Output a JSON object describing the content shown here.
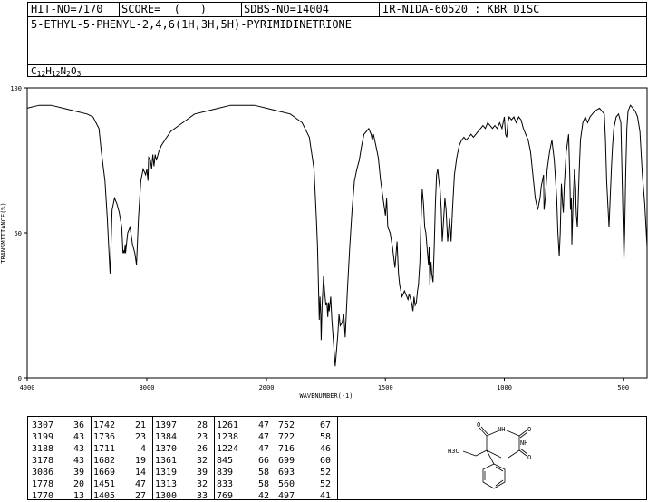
{
  "header": {
    "hit_no": "HIT-NO=7170",
    "score": "SCORE=  (   )",
    "sdbs_no": "SDBS-NO=14004",
    "ir_code": "IR-NIDA-60520 : KBR DISC",
    "compound_name": "5-ETHYL-5-PHENYL-2,4,6(1H,3H,5H)-PYRIMIDINETRIONE",
    "formula": {
      "c": "C",
      "c_n": "12",
      "h": "H",
      "h_n": "12",
      "n": "N",
      "n_n": "2",
      "o": "O",
      "o_n": "3"
    }
  },
  "chart_data": {
    "type": "line",
    "xlabel": "WAVENUMBER(-1)",
    "ylabel": "TRANSMITTANCE(%)",
    "xlim": [
      4000,
      400
    ],
    "ylim": [
      0,
      100
    ],
    "x_ticks": [
      "4000",
      "3000",
      "2000",
      "1500",
      "1000",
      "500"
    ],
    "y_ticks": [
      "100",
      "50",
      "0"
    ],
    "series": [
      {
        "points": [
          [
            4000,
            93
          ],
          [
            3900,
            94
          ],
          [
            3800,
            94
          ],
          [
            3700,
            93
          ],
          [
            3600,
            92
          ],
          [
            3500,
            91
          ],
          [
            3450,
            90
          ],
          [
            3400,
            86
          ],
          [
            3380,
            78
          ],
          [
            3350,
            68
          ],
          [
            3330,
            55
          ],
          [
            3310,
            38
          ],
          [
            3307,
            36
          ],
          [
            3300,
            45
          ],
          [
            3290,
            58
          ],
          [
            3270,
            62
          ],
          [
            3250,
            60
          ],
          [
            3230,
            57
          ],
          [
            3210,
            52
          ],
          [
            3199,
            43
          ],
          [
            3190,
            44
          ],
          [
            3188,
            43
          ],
          [
            3180,
            46
          ],
          [
            3178,
            43
          ],
          [
            3160,
            50
          ],
          [
            3140,
            52
          ],
          [
            3120,
            46
          ],
          [
            3100,
            43
          ],
          [
            3086,
            39
          ],
          [
            3070,
            55
          ],
          [
            3050,
            68
          ],
          [
            3030,
            72
          ],
          [
            3010,
            70
          ],
          [
            3000,
            72
          ],
          [
            2990,
            68
          ],
          [
            2985,
            76
          ],
          [
            2970,
            75
          ],
          [
            2960,
            72
          ],
          [
            2950,
            77
          ],
          [
            2940,
            73
          ],
          [
            2930,
            77
          ],
          [
            2920,
            75
          ],
          [
            2900,
            78
          ],
          [
            2880,
            80
          ],
          [
            2850,
            82
          ],
          [
            2800,
            85
          ],
          [
            2700,
            88
          ],
          [
            2600,
            91
          ],
          [
            2500,
            92
          ],
          [
            2400,
            93
          ],
          [
            2300,
            94
          ],
          [
            2200,
            94
          ],
          [
            2100,
            94
          ],
          [
            2000,
            93
          ],
          [
            1950,
            92
          ],
          [
            1900,
            91
          ],
          [
            1850,
            88
          ],
          [
            1820,
            83
          ],
          [
            1800,
            72
          ],
          [
            1790,
            55
          ],
          [
            1785,
            45
          ],
          [
            1778,
            20
          ],
          [
            1775,
            28
          ],
          [
            1772,
            22
          ],
          [
            1770,
            13
          ],
          [
            1766,
            25
          ],
          [
            1760,
            35
          ],
          [
            1756,
            30
          ],
          [
            1750,
            25
          ],
          [
            1746,
            26
          ],
          [
            1742,
            21
          ],
          [
            1739,
            26
          ],
          [
            1736,
            23
          ],
          [
            1730,
            28
          ],
          [
            1725,
            20
          ],
          [
            1711,
            4
          ],
          [
            1700,
            15
          ],
          [
            1695,
            22
          ],
          [
            1690,
            18
          ],
          [
            1682,
            19
          ],
          [
            1675,
            22
          ],
          [
            1669,
            14
          ],
          [
            1660,
            30
          ],
          [
            1650,
            45
          ],
          [
            1640,
            58
          ],
          [
            1630,
            68
          ],
          [
            1620,
            72
          ],
          [
            1610,
            75
          ],
          [
            1600,
            80
          ],
          [
            1590,
            84
          ],
          [
            1580,
            85
          ],
          [
            1570,
            86
          ],
          [
            1560,
            84
          ],
          [
            1555,
            82
          ],
          [
            1550,
            84
          ],
          [
            1540,
            80
          ],
          [
            1530,
            76
          ],
          [
            1520,
            68
          ],
          [
            1510,
            62
          ],
          [
            1500,
            56
          ],
          [
            1495,
            62
          ],
          [
            1490,
            52
          ],
          [
            1480,
            50
          ],
          [
            1470,
            45
          ],
          [
            1460,
            38
          ],
          [
            1451,
            47
          ],
          [
            1445,
            36
          ],
          [
            1440,
            32
          ],
          [
            1430,
            28
          ],
          [
            1420,
            30
          ],
          [
            1410,
            28
          ],
          [
            1405,
            27
          ],
          [
            1400,
            29
          ],
          [
            1397,
            28
          ],
          [
            1390,
            26
          ],
          [
            1384,
            23
          ],
          [
            1380,
            28
          ],
          [
            1375,
            25
          ],
          [
            1370,
            26
          ],
          [
            1365,
            30
          ],
          [
            1361,
            32
          ],
          [
            1355,
            40
          ],
          [
            1350,
            55
          ],
          [
            1345,
            65
          ],
          [
            1340,
            60
          ],
          [
            1335,
            52
          ],
          [
            1330,
            50
          ],
          [
            1325,
            45
          ],
          [
            1319,
            39
          ],
          [
            1316,
            45
          ],
          [
            1313,
            32
          ],
          [
            1308,
            40
          ],
          [
            1305,
            36
          ],
          [
            1300,
            33
          ],
          [
            1295,
            45
          ],
          [
            1290,
            60
          ],
          [
            1285,
            70
          ],
          [
            1280,
            72
          ],
          [
            1275,
            68
          ],
          [
            1270,
            65
          ],
          [
            1265,
            58
          ],
          [
            1261,
            47
          ],
          [
            1255,
            55
          ],
          [
            1250,
            62
          ],
          [
            1245,
            58
          ],
          [
            1238,
            47
          ],
          [
            1230,
            55
          ],
          [
            1224,
            47
          ],
          [
            1218,
            58
          ],
          [
            1210,
            70
          ],
          [
            1200,
            76
          ],
          [
            1190,
            80
          ],
          [
            1180,
            82
          ],
          [
            1170,
            83
          ],
          [
            1160,
            82
          ],
          [
            1150,
            83
          ],
          [
            1140,
            84
          ],
          [
            1130,
            83
          ],
          [
            1120,
            84
          ],
          [
            1110,
            85
          ],
          [
            1100,
            86
          ],
          [
            1090,
            87
          ],
          [
            1080,
            86
          ],
          [
            1070,
            88
          ],
          [
            1060,
            87
          ],
          [
            1050,
            86
          ],
          [
            1040,
            87
          ],
          [
            1030,
            86
          ],
          [
            1020,
            88
          ],
          [
            1010,
            86
          ],
          [
            1000,
            90
          ],
          [
            995,
            84
          ],
          [
            990,
            83
          ],
          [
            985,
            88
          ],
          [
            980,
            90
          ],
          [
            970,
            89
          ],
          [
            960,
            90
          ],
          [
            950,
            88
          ],
          [
            940,
            90
          ],
          [
            930,
            89
          ],
          [
            920,
            86
          ],
          [
            910,
            84
          ],
          [
            900,
            82
          ],
          [
            890,
            78
          ],
          [
            880,
            70
          ],
          [
            870,
            62
          ],
          [
            860,
            58
          ],
          [
            855,
            60
          ],
          [
            850,
            62
          ],
          [
            845,
            66
          ],
          [
            840,
            68
          ],
          [
            835,
            70
          ],
          [
            833,
            58
          ],
          [
            828,
            62
          ],
          [
            820,
            72
          ],
          [
            810,
            78
          ],
          [
            800,
            82
          ],
          [
            790,
            75
          ],
          [
            780,
            62
          ],
          [
            775,
            50
          ],
          [
            769,
            42
          ],
          [
            765,
            50
          ],
          [
            760,
            67
          ],
          [
            755,
            60
          ],
          [
            752,
            57
          ],
          [
            748,
            66
          ],
          [
            740,
            78
          ],
          [
            730,
            84
          ],
          [
            725,
            70
          ],
          [
            722,
            58
          ],
          [
            718,
            62
          ],
          [
            716,
            46
          ],
          [
            712,
            58
          ],
          [
            705,
            72
          ],
          [
            700,
            65
          ],
          [
            699,
            60
          ],
          [
            697,
            56
          ],
          [
            693,
            52
          ],
          [
            690,
            60
          ],
          [
            685,
            72
          ],
          [
            680,
            82
          ],
          [
            670,
            88
          ],
          [
            660,
            90
          ],
          [
            650,
            88
          ],
          [
            640,
            90
          ],
          [
            620,
            92
          ],
          [
            600,
            93
          ],
          [
            590,
            92
          ],
          [
            580,
            91
          ],
          [
            575,
            82
          ],
          [
            570,
            68
          ],
          [
            565,
            60
          ],
          [
            560,
            52
          ],
          [
            555,
            62
          ],
          [
            550,
            72
          ],
          [
            545,
            80
          ],
          [
            540,
            86
          ],
          [
            530,
            90
          ],
          [
            520,
            91
          ],
          [
            510,
            88
          ],
          [
            505,
            70
          ],
          [
            500,
            50
          ],
          [
            497,
            41
          ],
          [
            494,
            50
          ],
          [
            490,
            70
          ],
          [
            485,
            86
          ],
          [
            480,
            92
          ],
          [
            470,
            94
          ],
          [
            460,
            93
          ],
          [
            450,
            92
          ],
          [
            440,
            90
          ],
          [
            430,
            85
          ],
          [
            420,
            70
          ],
          [
            410,
            60
          ],
          [
            400,
            45
          ]
        ]
      }
    ]
  },
  "peaks": [
    [
      [
        "3307",
        "36"
      ],
      [
        "3199",
        "43"
      ],
      [
        "3188",
        "43"
      ],
      [
        "3178",
        "43"
      ],
      [
        "3086",
        "39"
      ],
      [
        "1778",
        "20"
      ],
      [
        "1770",
        "13"
      ]
    ],
    [
      [
        "1742",
        "21"
      ],
      [
        "1736",
        "23"
      ],
      [
        "1711",
        "4"
      ],
      [
        "1682",
        "19"
      ],
      [
        "1669",
        "14"
      ],
      [
        "1451",
        "47"
      ],
      [
        "1405",
        "27"
      ]
    ],
    [
      [
        "1397",
        "28"
      ],
      [
        "1384",
        "23"
      ],
      [
        "1370",
        "26"
      ],
      [
        "1361",
        "32"
      ],
      [
        "1319",
        "39"
      ],
      [
        "1313",
        "32"
      ],
      [
        "1300",
        "33"
      ]
    ],
    [
      [
        "1261",
        "47"
      ],
      [
        "1238",
        "47"
      ],
      [
        "1224",
        "47"
      ],
      [
        "845",
        "66"
      ],
      [
        "839",
        "58"
      ],
      [
        "833",
        "58"
      ],
      [
        "769",
        "42"
      ]
    ],
    [
      [
        "752",
        "67"
      ],
      [
        "722",
        "58"
      ],
      [
        "716",
        "46"
      ],
      [
        "699",
        "60"
      ],
      [
        "693",
        "52"
      ],
      [
        "560",
        "52"
      ],
      [
        "497",
        "41"
      ]
    ]
  ],
  "structure": {
    "labels": {
      "o_top": "O",
      "o_left": "O",
      "o_bottom": "O",
      "nh_top": "NH",
      "nh_right": "NH",
      "ethyl": "H3C"
    }
  }
}
